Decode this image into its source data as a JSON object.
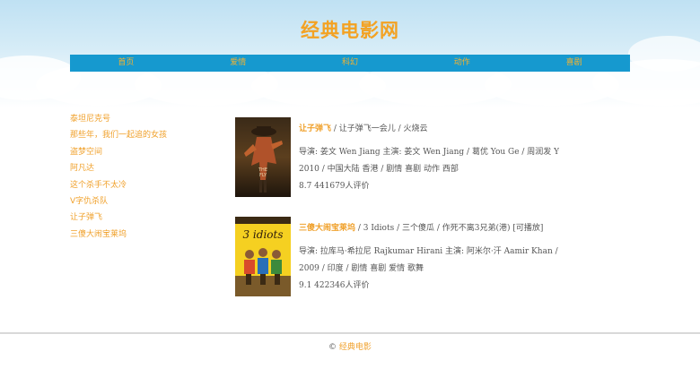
{
  "site": {
    "title": "经典电影网"
  },
  "nav": {
    "items": [
      {
        "label": "首页"
      },
      {
        "label": "爱情"
      },
      {
        "label": "科幻"
      },
      {
        "label": "动作"
      },
      {
        "label": "喜剧"
      }
    ]
  },
  "sidebar": {
    "links": [
      {
        "label": "泰坦尼克号"
      },
      {
        "label": "那些年，我们一起追的女孩"
      },
      {
        "label": "盗梦空间"
      },
      {
        "label": "阿凡达"
      },
      {
        "label": "这个杀手不太冷"
      },
      {
        "label": "V字仇杀队"
      },
      {
        "label": "让子弹飞"
      },
      {
        "label": "三傻大闹宝莱坞"
      }
    ]
  },
  "movies": [
    {
      "name": "让子弹飞",
      "alt_titles": " / 让子弹飞一会儿 / 火烧云",
      "staff": "导演: 姜文 Wen Jiang 主演: 姜文 Wen Jiang / 葛优 You Ge / 周润发 Yun-F...",
      "meta": "2010 / 中国大陆 香港 / 剧情 喜剧 动作 西部",
      "rating": "8.7 441679人评价",
      "poster_text": "让子弹飞"
    },
    {
      "name": "三傻大闹宝莱坞",
      "alt_titles": " / 3 Idiots / 三个傻瓜 / 作死不离3兄弟(港) [可播放]",
      "staff": "导演: 拉库马·希拉尼 Rajkumar Hirani 主演: 阿米尔·汗 Aamir Khan / 卡...",
      "meta": "2009 / 印度 / 剧情 喜剧 爱情 歌舞",
      "rating": "9.1 422346人评价",
      "poster_text": "3 idiots"
    }
  ],
  "footer": {
    "copyright": "©",
    "link": "经典电影"
  },
  "colors": {
    "accent": "#f0a12c",
    "nav_bg": "#1699cf"
  }
}
